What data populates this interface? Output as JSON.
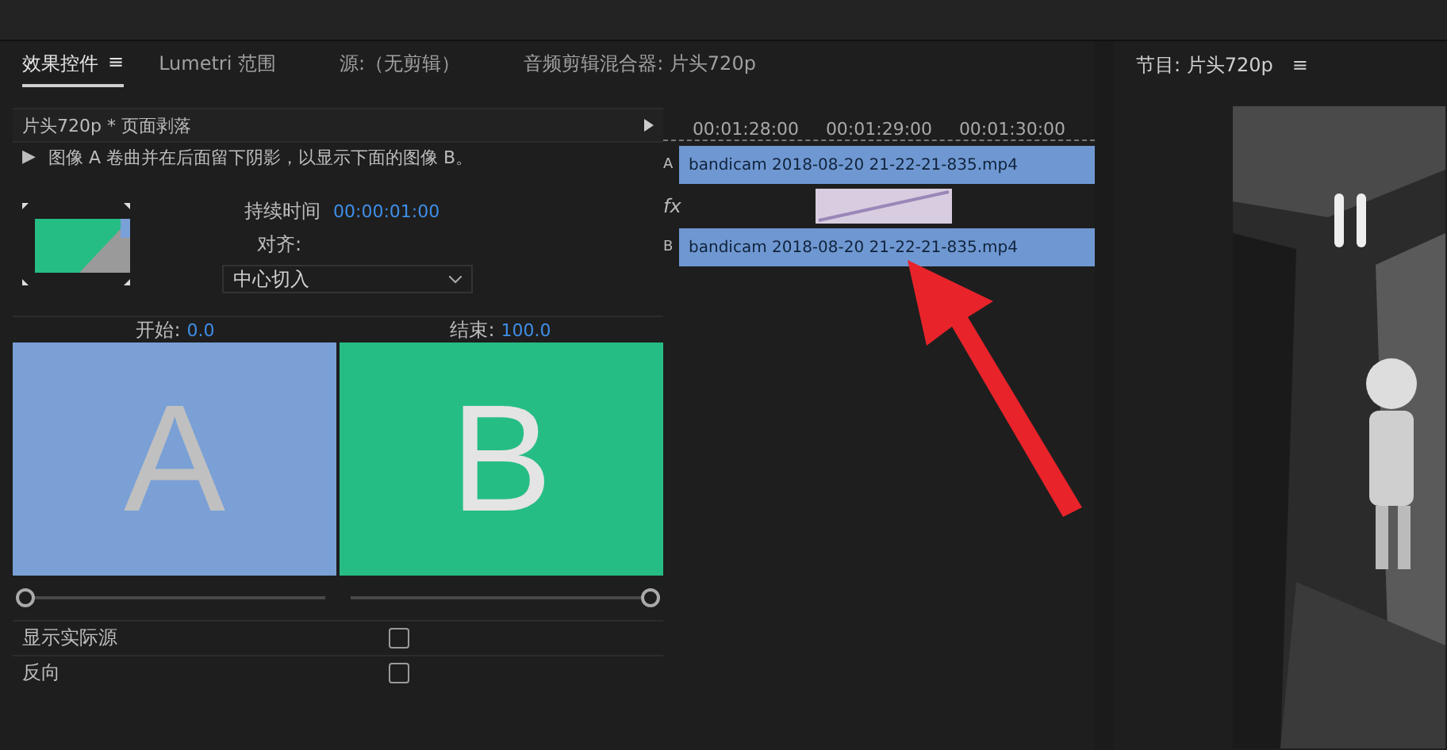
{
  "tabs": [
    {
      "label": "效果控件",
      "selected": true,
      "menu": "≡"
    },
    {
      "label": "Lumetri 范围",
      "selected": false
    },
    {
      "label": "源:（无剪辑）",
      "selected": false
    },
    {
      "label": "音频剪辑混合器: 片头720p",
      "selected": false
    }
  ],
  "effect": {
    "title": "片头720p * 页面剥落",
    "expand": "▶",
    "description": "图像 A 卷曲并在后面留下阴影，以显示下面的图像 B。",
    "duration_label": "持续时间",
    "duration": "00:00:01:00",
    "align_label": "对齐:",
    "align_value": "中心切入",
    "start_label": "开始:",
    "start_value": "0.0",
    "end_label": "结束:",
    "end_value": "100.0",
    "preview_a": "A",
    "preview_b": "B",
    "start_slider": {
      "level": 0
    },
    "end_slider": {
      "level": 1
    },
    "options": [
      {
        "label": "显示实际源",
        "checked": false
      },
      {
        "label": "反向",
        "checked": false
      }
    ]
  },
  "timeline": {
    "ticks": [
      "00:01:28:00",
      "00:01:29:00",
      "00:01:30:00"
    ],
    "track_a": "A",
    "track_b": "B",
    "fx": "fx",
    "clip_a": "bandicam 2018-08-20 21-22-21-835.mp4",
    "clip_b": "bandicam 2018-08-20 21-22-21-835.mp4"
  },
  "program": {
    "title": "节目: 片头720p",
    "menu": "≡"
  }
}
